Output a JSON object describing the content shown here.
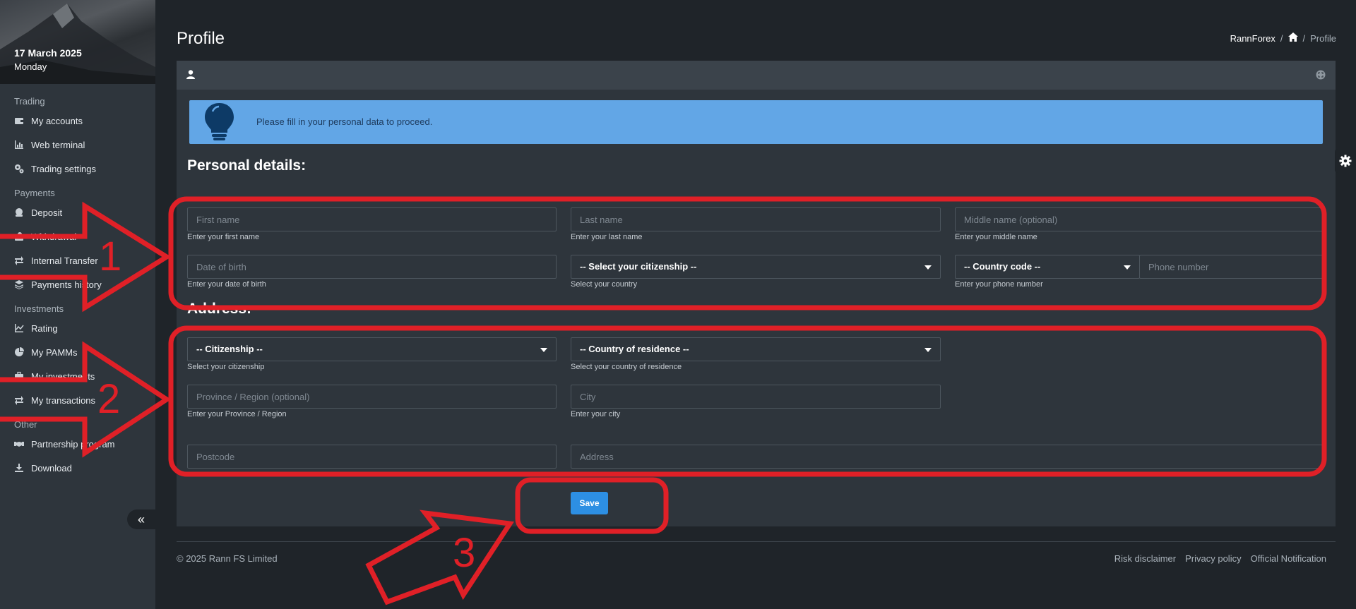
{
  "sidebar": {
    "date": "17 March 2025",
    "day": "Monday",
    "sections": {
      "trading": "Trading",
      "payments": "Payments",
      "investments": "Investments",
      "other": "Other"
    },
    "items": {
      "my_accounts": "My accounts",
      "web_terminal": "Web terminal",
      "trading_settings": "Trading settings",
      "deposit": "Deposit",
      "withdrawal": "Withdrawal",
      "internal_transfer": "Internal Transfer",
      "payments_history": "Payments history",
      "rating": "Rating",
      "my_pamms": "My PAMMs",
      "my_investments": "My investments",
      "my_transactions": "My transactions",
      "partnership_program": "Partnership program",
      "download": "Download"
    },
    "collapse_glyph": "«"
  },
  "header": {
    "title": "Profile",
    "breadcrumb": {
      "root": "RannForex",
      "separator": "/",
      "current": "Profile"
    }
  },
  "alert": {
    "text": "Please fill in your personal data to proceed.",
    "background": "#62a6e6"
  },
  "personal": {
    "title": "Personal details:",
    "first_name": {
      "placeholder": "First name",
      "help": "Enter your first name"
    },
    "last_name": {
      "placeholder": "Last name",
      "help": "Enter your last name"
    },
    "middle_name": {
      "placeholder": "Middle name (optional)",
      "help": "Enter your middle name"
    },
    "dob": {
      "placeholder": "Date of birth",
      "help": "Enter your date of birth"
    },
    "citizenship_select": {
      "value": "-- Select your citizenship --",
      "help": "Select your country"
    },
    "country_code": {
      "value": "-- Country code --"
    },
    "phone": {
      "placeholder": "Phone number",
      "help": "Enter your phone number"
    }
  },
  "address": {
    "title": "Address:",
    "citizenship": {
      "value": "-- Citizenship --",
      "help": "Select your citizenship"
    },
    "residence": {
      "value": "-- Country of residence --",
      "help": "Select your country of residence"
    },
    "province": {
      "placeholder": "Province / Region (optional)",
      "help": "Enter your Province / Region"
    },
    "city": {
      "placeholder": "City",
      "help": "Enter your city"
    },
    "postcode": {
      "placeholder": "Postcode"
    },
    "address_field": {
      "placeholder": "Address"
    }
  },
  "save_label": "Save",
  "footer": {
    "copyright": "© 2025 Rann FS Limited",
    "links": [
      "Risk disclaimer",
      "Privacy policy",
      "Official Notification"
    ]
  },
  "annotations": {
    "color": "#e02027",
    "labels": [
      "1",
      "2",
      "3"
    ]
  }
}
